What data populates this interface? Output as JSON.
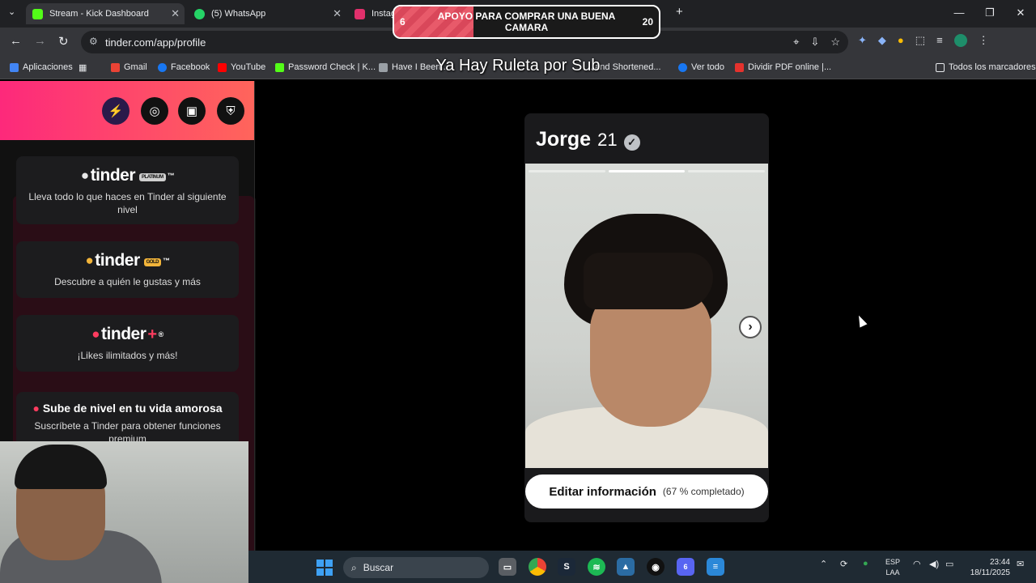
{
  "browser": {
    "tabs": [
      {
        "label": "Stream - Kick Dashboard",
        "color": "#53fc18"
      },
      {
        "label": "(5) WhatsApp",
        "color": "#25d366"
      },
      {
        "label": "Instag",
        "color": "#e1306c"
      }
    ],
    "new_tab": "+",
    "url": "tinder.com/app/profile",
    "bookmarks": [
      {
        "label": "Aplicaciones",
        "color": "#4285f4"
      },
      {
        "label": "Gmail",
        "color": "#ea4335"
      },
      {
        "label": "Facebook",
        "color": "#1877f2"
      },
      {
        "label": "YouTube",
        "color": "#ff0000"
      },
      {
        "label": "Password Check | K...",
        "color": "#53fc18"
      },
      {
        "label": "Have I Been...",
        "color": "#9aa0a6"
      },
      {
        "label": "...and Shortened...",
        "color": "#9aa0a6"
      },
      {
        "label": "Ver todo",
        "color": "#1877f2"
      },
      {
        "label": "Dividir PDF online |...",
        "color": "#e5322d"
      }
    ],
    "all_bookmarks": "Todos los marcadores"
  },
  "overlay": {
    "goal_current": "6",
    "goal_target": "20",
    "goal_text": "APOYO PARA COMPRAR UNA BUENA CAMARA",
    "progress": 0.3,
    "subtitle": "Ya Hay Ruleta por Sub"
  },
  "sidebar": {
    "plans": [
      {
        "brand": "tinder",
        "badge": "PLATINUM",
        "badge_color": "#cfcfcf",
        "tm": "™",
        "icon_color": "#e8e8e8",
        "description": "Lleva todo lo que haces en Tinder al siguiente nivel"
      },
      {
        "brand": "tinder",
        "badge": "GOLD",
        "badge_color": "#f2b43a",
        "tm": "™",
        "icon_color": "#f2b43a",
        "description": "Descubre a quién le gustas y más"
      },
      {
        "brand": "tinder",
        "badge": "+",
        "badge_color": "#fd3c5f",
        "tm": "®",
        "icon_color": "#fd3c5f",
        "description": "¡Likes ilimitados y más!"
      }
    ],
    "upsell": {
      "title": "Sube de nivel en tu vida amorosa",
      "description": "Suscríbete a Tinder para obtener funciones premium"
    }
  },
  "profile": {
    "name": "Jorge",
    "age": "21",
    "photo_count": 3,
    "active_photo": 2,
    "edit_label": "Editar información",
    "completion": "(67 % completado)"
  },
  "taskbar": {
    "search_placeholder": "Buscar",
    "discord_badge": "6",
    "language": "ESP",
    "layout": "LAA",
    "time": "23:44",
    "date": "18/11/2025"
  },
  "colors": {
    "tinder_gradient_start": "#fd297b",
    "tinder_gradient_end": "#ff655b"
  }
}
